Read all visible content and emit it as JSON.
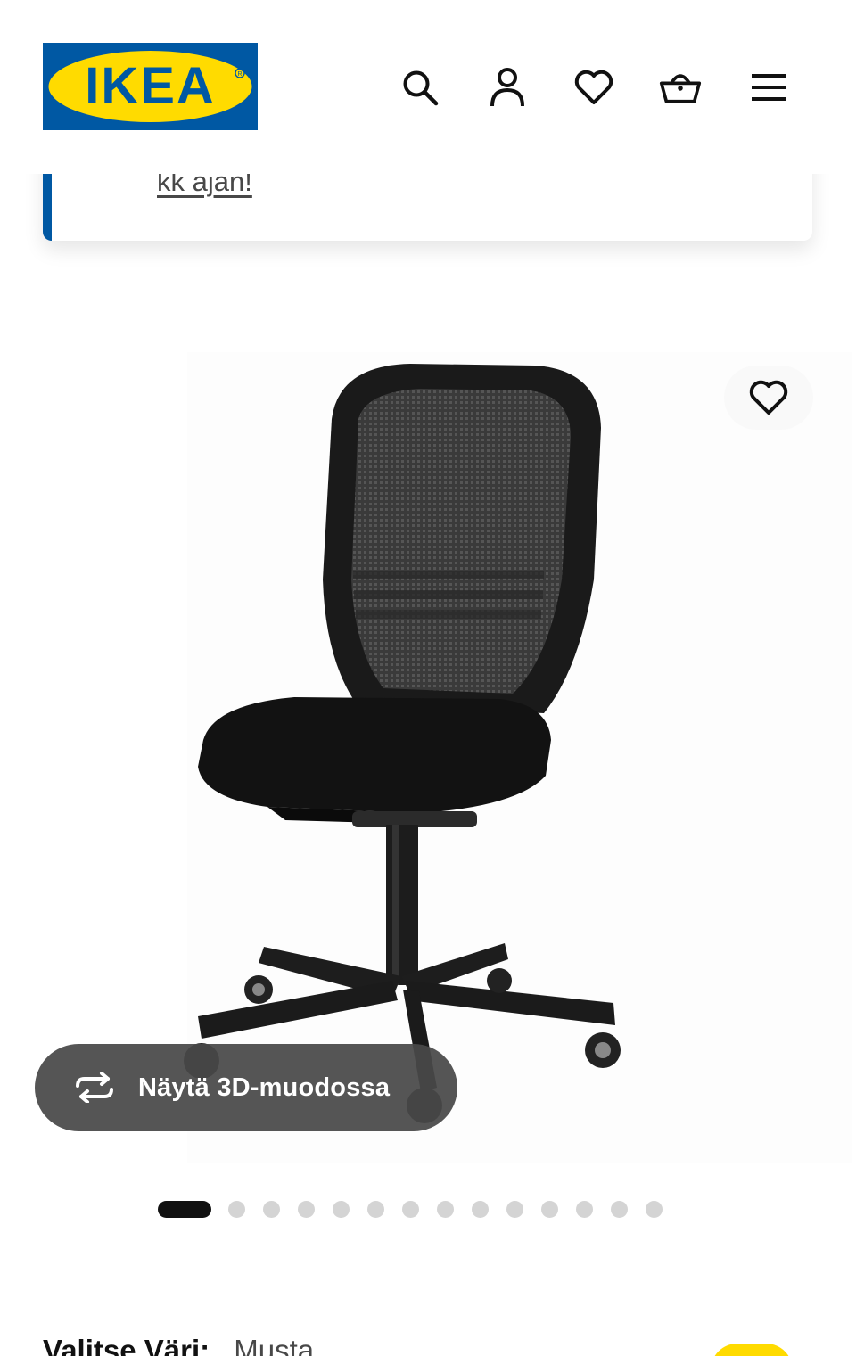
{
  "header": {
    "logo_text": "IKEA",
    "icons": [
      "search-icon",
      "user-icon",
      "heart-icon",
      "basket-icon",
      "menu-icon"
    ]
  },
  "banner": {
    "link_text": "kk ajan!"
  },
  "gallery": {
    "view_3d_label": "Näytä 3D-muodossa",
    "slide_count": 14,
    "active_slide": 1
  },
  "product": {
    "color_label": "Valitse Väri:",
    "color_value": "Musta"
  },
  "colors": {
    "brand_blue": "#0058a3",
    "brand_yellow": "#ffdb00",
    "overlay_grey": "#484848"
  }
}
